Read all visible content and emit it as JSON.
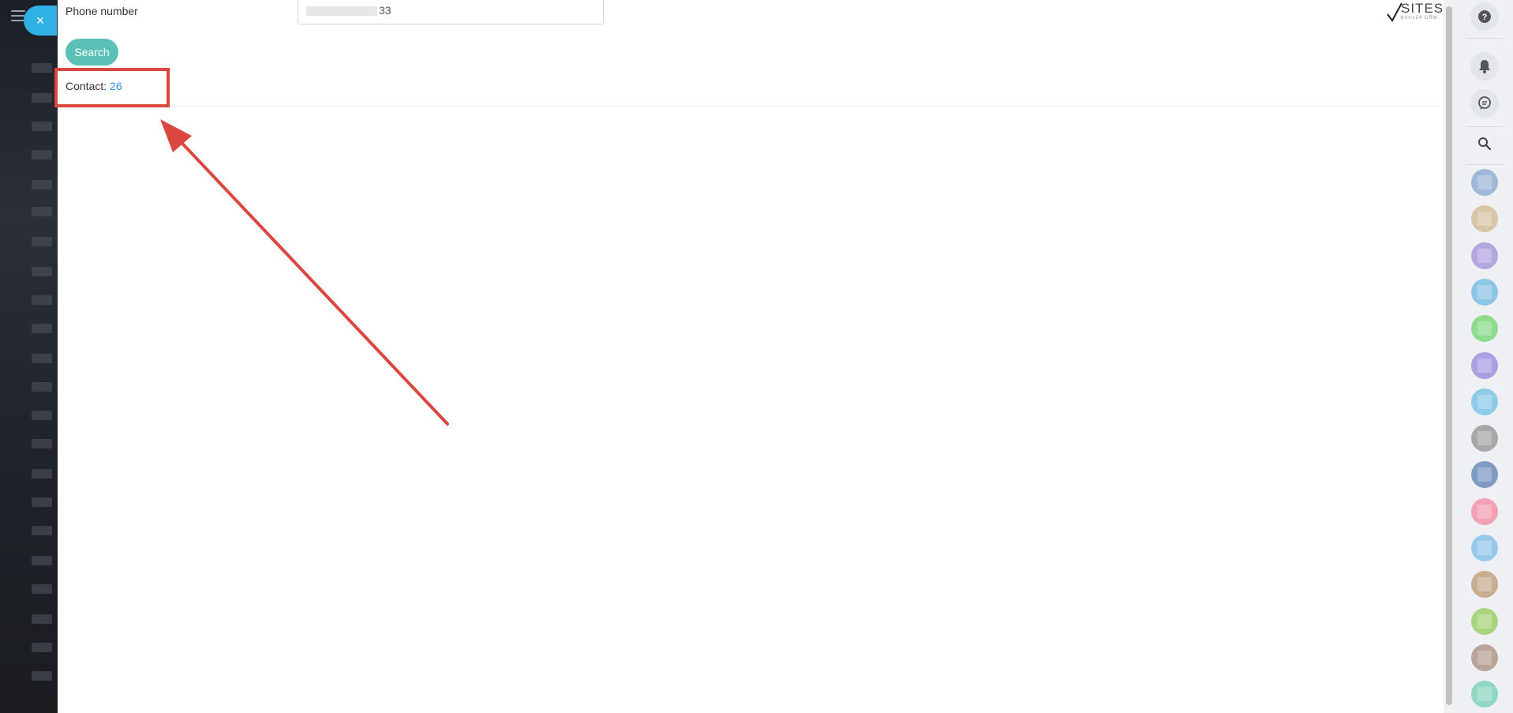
{
  "form": {
    "phone_label": "Phone number",
    "phone_value_visible_suffix": "33",
    "search_label": "Search"
  },
  "result": {
    "contact_label": "Contact:",
    "contact_count": "26"
  },
  "logo": {
    "text": "SITES",
    "subtext": "bitrix24 CRM"
  },
  "close_icon": "×",
  "sidebar": {
    "icons": [
      "help-icon",
      "bell-icon",
      "chat-icon",
      "search-icon"
    ],
    "avatar_colors": [
      "#9fb8d8",
      "#d9c6a8",
      "#b6a6e0",
      "#8cc6e6",
      "#8fdc8f",
      "#ab9ee2",
      "#8fcbe8",
      "#a7a7a7",
      "#7f9bc4",
      "#f3a0b4",
      "#98c9ea",
      "#c9ad90",
      "#a8d47e",
      "#b9a497",
      "#8fd7c0"
    ]
  },
  "colors": {
    "annotation": "#d9473f",
    "accent_button": "#5bc0b5",
    "link": "#2f8fe0",
    "close_button": "#2fb1e6"
  }
}
